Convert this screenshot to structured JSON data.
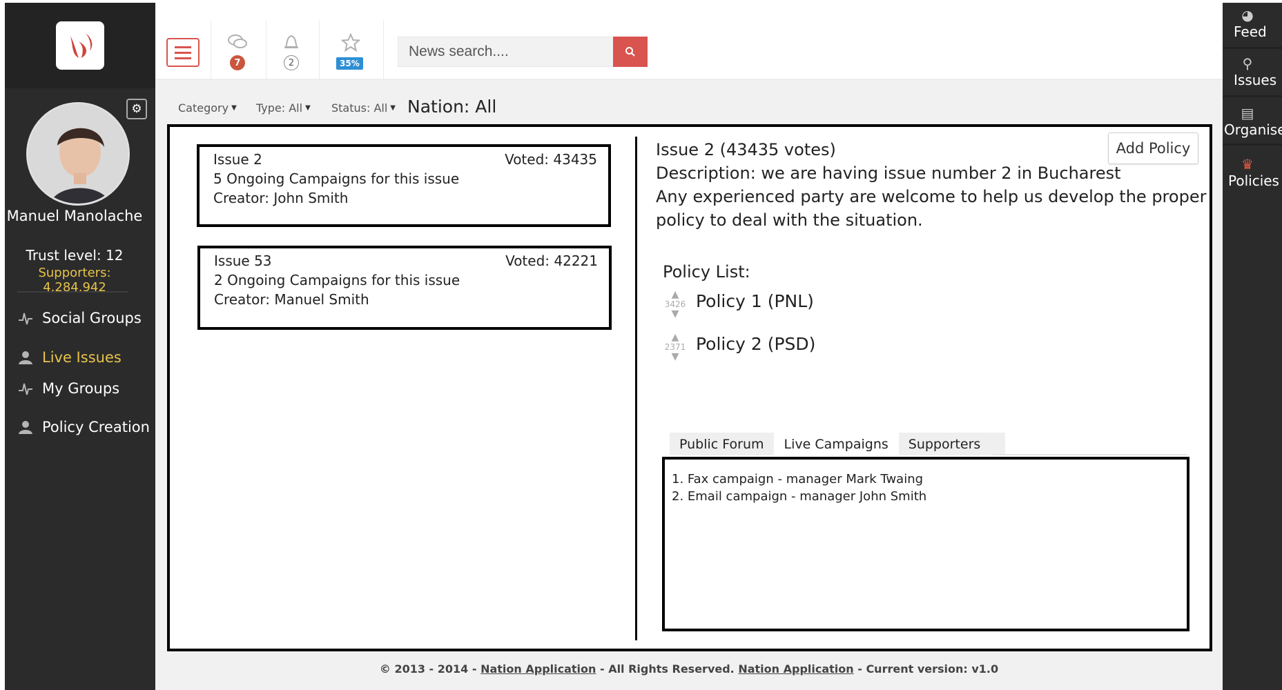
{
  "sidebar": {
    "user_name": "Manuel Manolache",
    "trust": "Trust level: 12",
    "supporters": "Supporters: 4.284.942",
    "items": [
      {
        "label": "Social Groups",
        "icon": "pulse-icon"
      },
      {
        "label": "Live Issues",
        "icon": "user-icon"
      },
      {
        "label": "My Groups",
        "icon": "pulse-icon"
      },
      {
        "label": "Policy Creation",
        "icon": "user-icon"
      }
    ]
  },
  "topbar": {
    "messages_count": "7",
    "notifications_count": "2",
    "progress_label": "35%",
    "search_placeholder": "News search...."
  },
  "right_sidebar": {
    "items": [
      {
        "label": "Feed",
        "icon": "globe-icon"
      },
      {
        "label": "Issues",
        "icon": "map-pin-icon"
      },
      {
        "label": "Organise",
        "icon": "document-icon"
      },
      {
        "label": "Policies",
        "icon": "crown-icon"
      }
    ]
  },
  "filters": {
    "category": "Category",
    "type": "Type: All",
    "status": "Status: All",
    "nation": "Nation: All"
  },
  "issues": [
    {
      "title": "Issue 2",
      "voted": "Voted: 43435",
      "campaigns": "5 Ongoing Campaigns for this issue",
      "creator": "Creator: John Smith"
    },
    {
      "title": "Issue 53",
      "voted": "Voted: 42221",
      "campaigns": "2 Ongoing Campaigns for this issue",
      "creator": "Creator: Manuel Smith"
    }
  ],
  "detail": {
    "heading": "Issue 2 (43435 votes)",
    "description": "Description: we are having issue number 2 in Bucharest",
    "line2": "Any experienced party are welcome to help us develop the proper",
    "line3": "policy to deal with the situation.",
    "add_policy": "Add Policy",
    "policy_list_label": "Policy List:",
    "policies": [
      {
        "votes": "3426",
        "name": "Policy 1 (PNL)"
      },
      {
        "votes": "2371",
        "name": "Policy 2 (PSD)"
      }
    ]
  },
  "tabs": [
    "Public Forum",
    "Live Campaigns",
    "Supporters"
  ],
  "campaigns": [
    "1. Fax campaign - manager Mark Twaing",
    "2. Email campaign  - manager John Smith"
  ],
  "footer": {
    "prefix": "© 2013 - 2014 - ",
    "link1": "Nation Application",
    "middle": " - All Rights Reserved. ",
    "link2": "Nation Application",
    "suffix": " - Current version: v1.0"
  }
}
